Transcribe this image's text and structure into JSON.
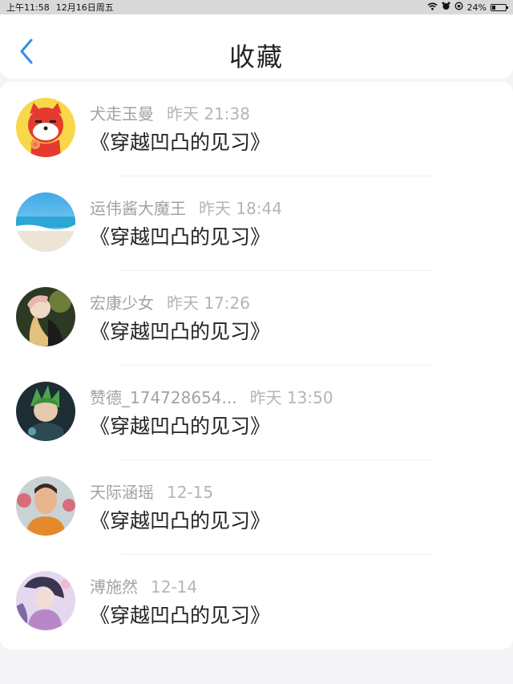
{
  "status_bar": {
    "time": "上午11:58",
    "date": "12月16日周五",
    "battery": "24%",
    "battery_level": 0.24,
    "icons": [
      "wifi-icon",
      "alarm-icon",
      "orientation-lock-icon",
      "battery-icon"
    ]
  },
  "header": {
    "title": "收藏",
    "back_icon": "chevron-left-icon",
    "accent_color": "#2f8ff0"
  },
  "favorites": [
    {
      "name": "犬走玉曼",
      "time": "昨天 21:38",
      "title": "《穿越凹凸的见习》"
    },
    {
      "name": "运伟酱大魔王",
      "time": "昨天 18:44",
      "title": "《穿越凹凸的见习》"
    },
    {
      "name": "宏康少女",
      "time": "昨天 17:26",
      "title": "《穿越凹凸的见习》"
    },
    {
      "name": "赞德_174728654...",
      "time": "昨天 13:50",
      "title": "《穿越凹凸的见习》"
    },
    {
      "name": "天际涵瑶",
      "time": "12-15",
      "title": "《穿越凹凸的见习》"
    },
    {
      "name": "溥施然",
      "time": "12-14",
      "title": "《穿越凹凸的见习》"
    }
  ]
}
